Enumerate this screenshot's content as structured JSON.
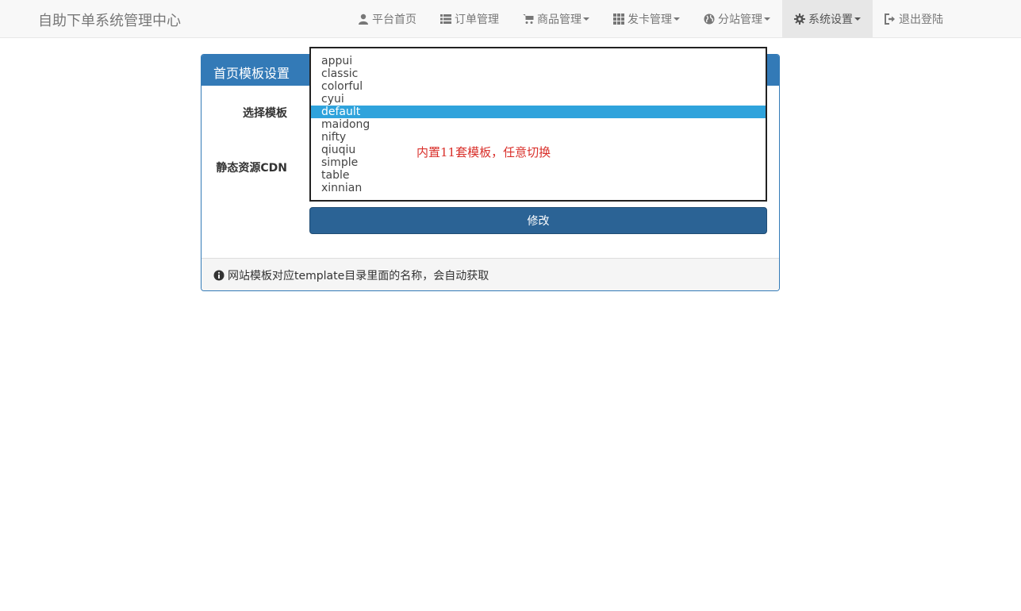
{
  "navbar": {
    "brand": "自助下单系统管理中心",
    "items": [
      {
        "label": "平台首页",
        "icon": "user-icon",
        "dropdown": false,
        "active": false
      },
      {
        "label": "订单管理",
        "icon": "list-icon",
        "dropdown": false,
        "active": false
      },
      {
        "label": "商品管理",
        "icon": "cart-icon",
        "dropdown": true,
        "active": false
      },
      {
        "label": "发卡管理",
        "icon": "grid-icon",
        "dropdown": true,
        "active": false
      },
      {
        "label": "分站管理",
        "icon": "globe-icon",
        "dropdown": true,
        "active": false
      },
      {
        "label": "系统设置",
        "icon": "gear-icon",
        "dropdown": true,
        "active": true
      },
      {
        "label": "退出登陆",
        "icon": "logout-icon",
        "dropdown": false,
        "active": false
      }
    ]
  },
  "panel": {
    "title": "首页模板设置",
    "template_label": "选择模板",
    "cdn_label": "静态资源CDN",
    "submit_label": "修改",
    "footer_note": "网站模板对应template目录里面的名称，会自动获取"
  },
  "template_select": {
    "options": [
      "appui",
      "classic",
      "colorful",
      "cyui",
      "default",
      "maidong",
      "nifty",
      "qiuqiu",
      "simple",
      "table",
      "xinnian"
    ],
    "selected": "default"
  },
  "annotation": "内置11套模板，任意切换",
  "colors": {
    "primary": "#337ab7",
    "button": "#2b6395",
    "highlight": "#2fa3dc",
    "annotation": "#d9302b"
  }
}
